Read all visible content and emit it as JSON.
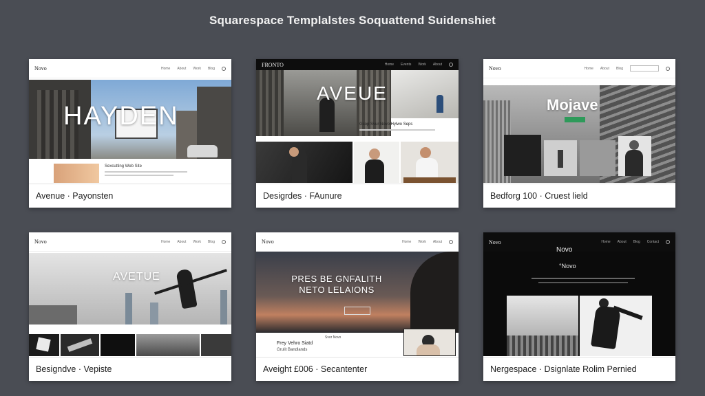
{
  "page": {
    "title": "Squarespace Templalstes Soquattend Suidenshiet"
  },
  "cards": [
    {
      "logo": "Novo",
      "hero": "HAYDEN",
      "caption": "Avenue · Payonsten",
      "nav": [
        "Home",
        "About",
        "Work",
        "Blog"
      ],
      "snippet": "Sexcutting Web Site"
    },
    {
      "logo": "FRONTO",
      "hero": "AVEUE",
      "caption": "Desigrdes · FAunure",
      "nav": [
        "Home",
        "Events",
        "Work",
        "About"
      ],
      "snippet": "Gsop Svur Novo Hylwo Seps"
    },
    {
      "logo": "Novo",
      "hero": "Mojave",
      "caption": "Bedforg 100 · Cruest lield",
      "nav": [
        "Home",
        "About",
        "Blog"
      ],
      "button": ""
    },
    {
      "logo": "Novo",
      "hero": "AVETUE",
      "caption": "Besigndve · Vepiste",
      "nav": [
        "Home",
        "About",
        "Work",
        "Blog"
      ]
    },
    {
      "logo": "Novo",
      "hero": "PRES BE GNFALITH NETO LELAIONS",
      "hero_line1": "PRES BE GNFALITH",
      "hero_line2": "NETO LELAIONS",
      "caption": "Aveight £006 · Secantenter",
      "nav": [
        "Home",
        "Work",
        "About"
      ],
      "lower_text_1": "Svor Novo",
      "lower_text_2": "Frey Vehro Siatd",
      "lower_text_3": "Grulit Bandlands"
    },
    {
      "logo": "Novo",
      "hero": "Novo",
      "subhero": "°Novo",
      "caption": "Nergespace · Dsignlate Rolim Pernied",
      "nav": [
        "Home",
        "About",
        "Blog",
        "Contact"
      ]
    }
  ],
  "colors": {
    "background": "#4a4d54",
    "card": "#ffffff",
    "green_button": "#2e9a5a"
  }
}
